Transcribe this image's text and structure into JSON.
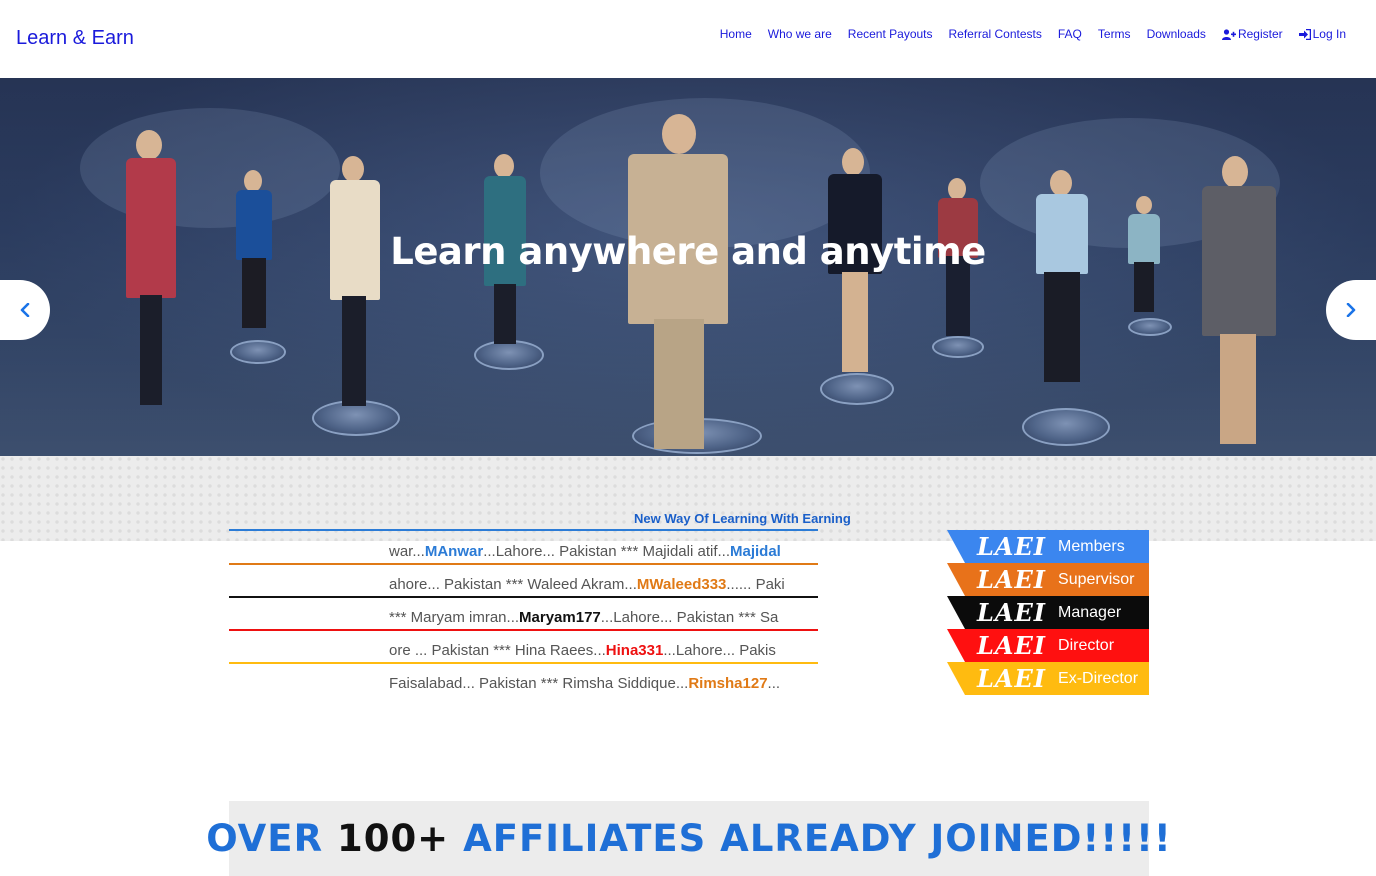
{
  "brand": "Learn & Earn",
  "nav": {
    "home": "Home",
    "who": "Who we are",
    "payouts": "Recent Payouts",
    "contests": "Referral Contests",
    "faq": "FAQ",
    "terms": "Terms",
    "downloads": "Downloads",
    "register": "Register",
    "login": "Log In"
  },
  "hero": {
    "title": "Learn anywhere and anytime"
  },
  "tagline": "New Way Of Learning With Earning",
  "tickers": [
    {
      "color": "#2b7bd6",
      "pre": "war...",
      "bold": "MAnwar",
      "mid": "...Lahore... Pakistan *** Majidali atif...",
      "bold2": "Majidal",
      "post": ""
    },
    {
      "color": "#e07a16",
      "pre": "ahore... Pakistan *** Waleed Akram...",
      "bold": "MWaleed333",
      "mid": "...... Paki",
      "bold2": "",
      "post": ""
    },
    {
      "color": "#111111",
      "pre": " *** Maryam imran...",
      "bold": "Maryam177",
      "mid": "...Lahore... Pakistan *** Sa",
      "bold2": "",
      "post": ""
    },
    {
      "color": "#ee1111",
      "pre": "ore ... Pakistan *** Hina Raees...",
      "bold": "Hina331",
      "mid": "...Lahore... Pakis",
      "bold2": "",
      "post": ""
    },
    {
      "color": "#e07a16",
      "pre": "Faisalabad... Pakistan *** Rimsha Siddique...",
      "bold": "Rimsha127",
      "mid": "...",
      "bold2": "",
      "post": ""
    }
  ],
  "ranks": [
    {
      "logo": "LAEI",
      "label": "Members",
      "color": "#3b86ef"
    },
    {
      "logo": "LAEI",
      "label": "Supervisor",
      "color": "#e8721a"
    },
    {
      "logo": "LAEI",
      "label": "Manager",
      "color": "#0b0b0b"
    },
    {
      "logo": "LAEI",
      "label": "Director",
      "color": "#ff1010"
    },
    {
      "logo": "LAEI",
      "label": "Ex-Director",
      "color": "#ffbb10"
    }
  ],
  "affiliates": {
    "part1": "OVER ",
    "part2": "100+",
    "part3": " AFFILIATES ALREADY JOINED!!!!!",
    "color_main": "#1f6fd6",
    "color_num": "#111111"
  },
  "icons": {
    "prev": "chevron-left-icon",
    "next": "chevron-right-icon",
    "register": "user-plus-icon",
    "login": "sign-in-icon"
  }
}
